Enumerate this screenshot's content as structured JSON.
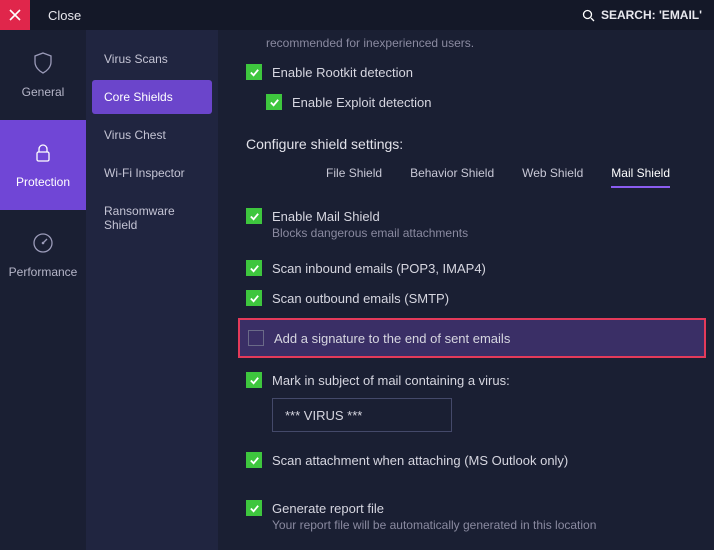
{
  "titlebar": {
    "close": "Close",
    "search": "SEARCH: 'EMAIL'"
  },
  "rail": {
    "general": "General",
    "protection": "Protection",
    "performance": "Performance"
  },
  "subnav": {
    "items": [
      {
        "label": "Virus Scans"
      },
      {
        "label": "Core Shields"
      },
      {
        "label": "Virus Chest"
      },
      {
        "label": "Wi-Fi Inspector"
      },
      {
        "label": "Ransomware Shield"
      }
    ]
  },
  "content": {
    "topHint": "recommended for inexperienced users.",
    "rootkit": "Enable Rootkit detection",
    "exploit": "Enable Exploit detection",
    "configure": "Configure shield settings:",
    "tabs": {
      "file": "File Shield",
      "behavior": "Behavior Shield",
      "web": "Web Shield",
      "mail": "Mail Shield"
    },
    "enableMail": "Enable Mail Shield",
    "enableMailDesc": "Blocks dangerous email attachments",
    "inbound": "Scan inbound emails (POP3, IMAP4)",
    "outbound": "Scan outbound emails (SMTP)",
    "signature": "Add a signature to the end of sent emails",
    "markSubject": "Mark in subject of mail containing a virus:",
    "virusText": "*** VIRUS ***",
    "attachment": "Scan attachment when attaching (MS Outlook only)",
    "report": "Generate report file",
    "reportDesc": "Your report file will be automatically generated in this location"
  }
}
